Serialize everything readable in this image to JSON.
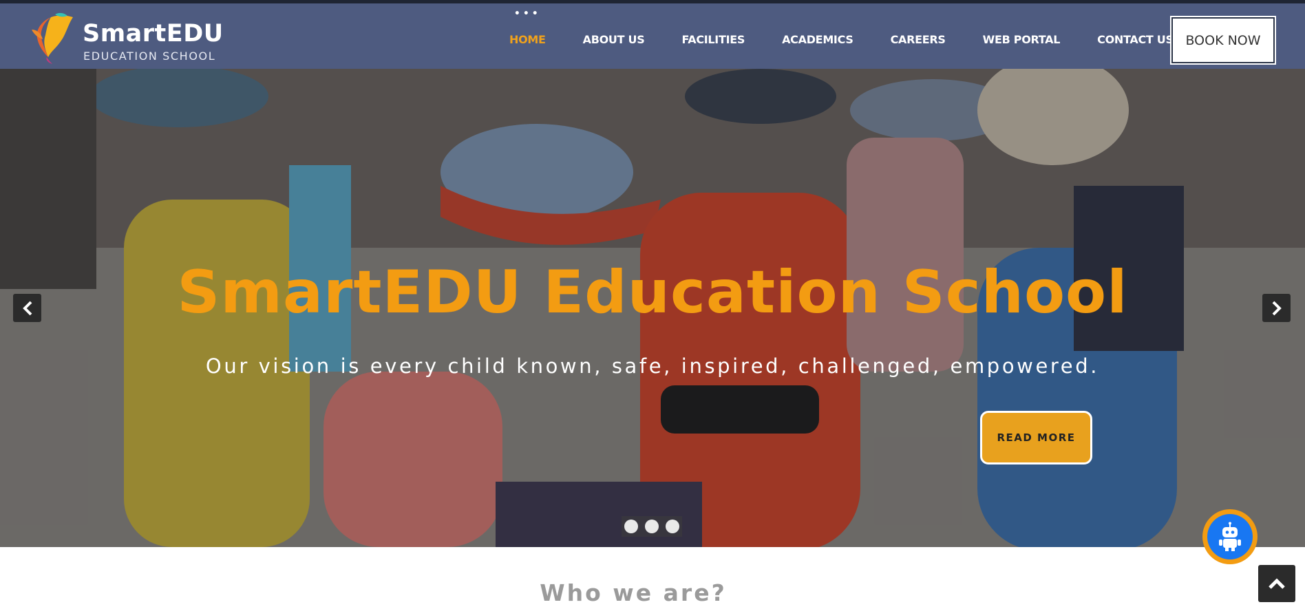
{
  "header": {
    "brand_name": "SmartEDU",
    "brand_subtitle": "EDUCATION SCHOOL",
    "nav": [
      {
        "label": "HOME",
        "active": true
      },
      {
        "label": "ABOUT US",
        "active": false
      },
      {
        "label": "FACILITIES",
        "active": false
      },
      {
        "label": "ACADEMICS",
        "active": false
      },
      {
        "label": "CAREERS",
        "active": false
      },
      {
        "label": "WEB PORTAL",
        "active": false
      },
      {
        "label": "CONTACT US",
        "active": false
      }
    ],
    "book_label": "BOOK NOW"
  },
  "hero": {
    "title": "SmartEDU Education School",
    "tagline": "Our vision is every child known, safe, inspired, challenged, empowered.",
    "cta_label": "READ MORE",
    "slide_count": 3,
    "prev_icon": "chevron-left-icon",
    "next_icon": "chevron-right-icon"
  },
  "section": {
    "heading": "Who we are?"
  },
  "floating": {
    "chatbot_icon": "robot-icon",
    "scroll_top_icon": "chevron-up-icon"
  },
  "colors": {
    "header_bg": "#4e5b80",
    "accent": "#f39c12",
    "chatbot_blue": "#1877f2"
  }
}
